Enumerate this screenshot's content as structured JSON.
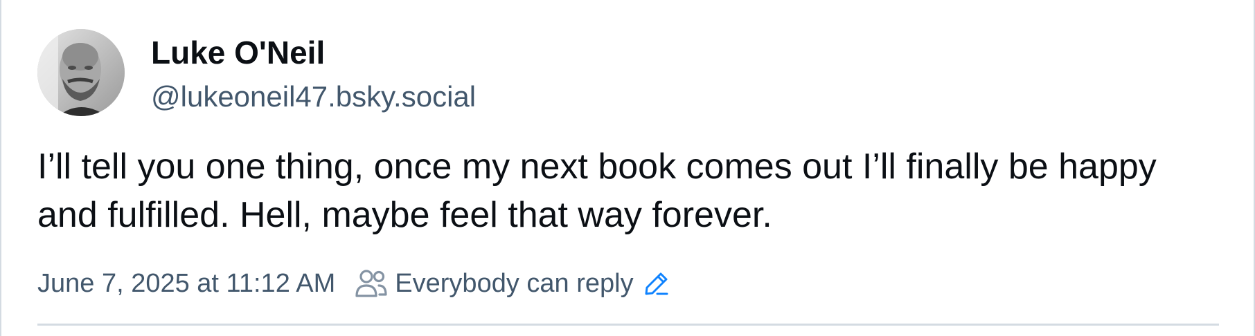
{
  "post": {
    "author": {
      "display_name": "Luke O'Neil",
      "handle": "@lukeoneil47.bsky.social",
      "avatar_icon": "avatar-photo"
    },
    "text": "I’ll tell you one thing, once my next book comes out I’ll finally be happy and fulfilled. Hell, maybe feel that way forever.",
    "timestamp": "June 7, 2025 at 11:12 AM",
    "reply_setting": {
      "label": "Everybody can reply",
      "icon": "people-icon",
      "edit_icon": "pencil-icon"
    }
  },
  "colors": {
    "text_primary": "#0b0f14",
    "text_secondary": "#42576c",
    "accent": "#1083fe",
    "border": "#d4dbe2"
  }
}
